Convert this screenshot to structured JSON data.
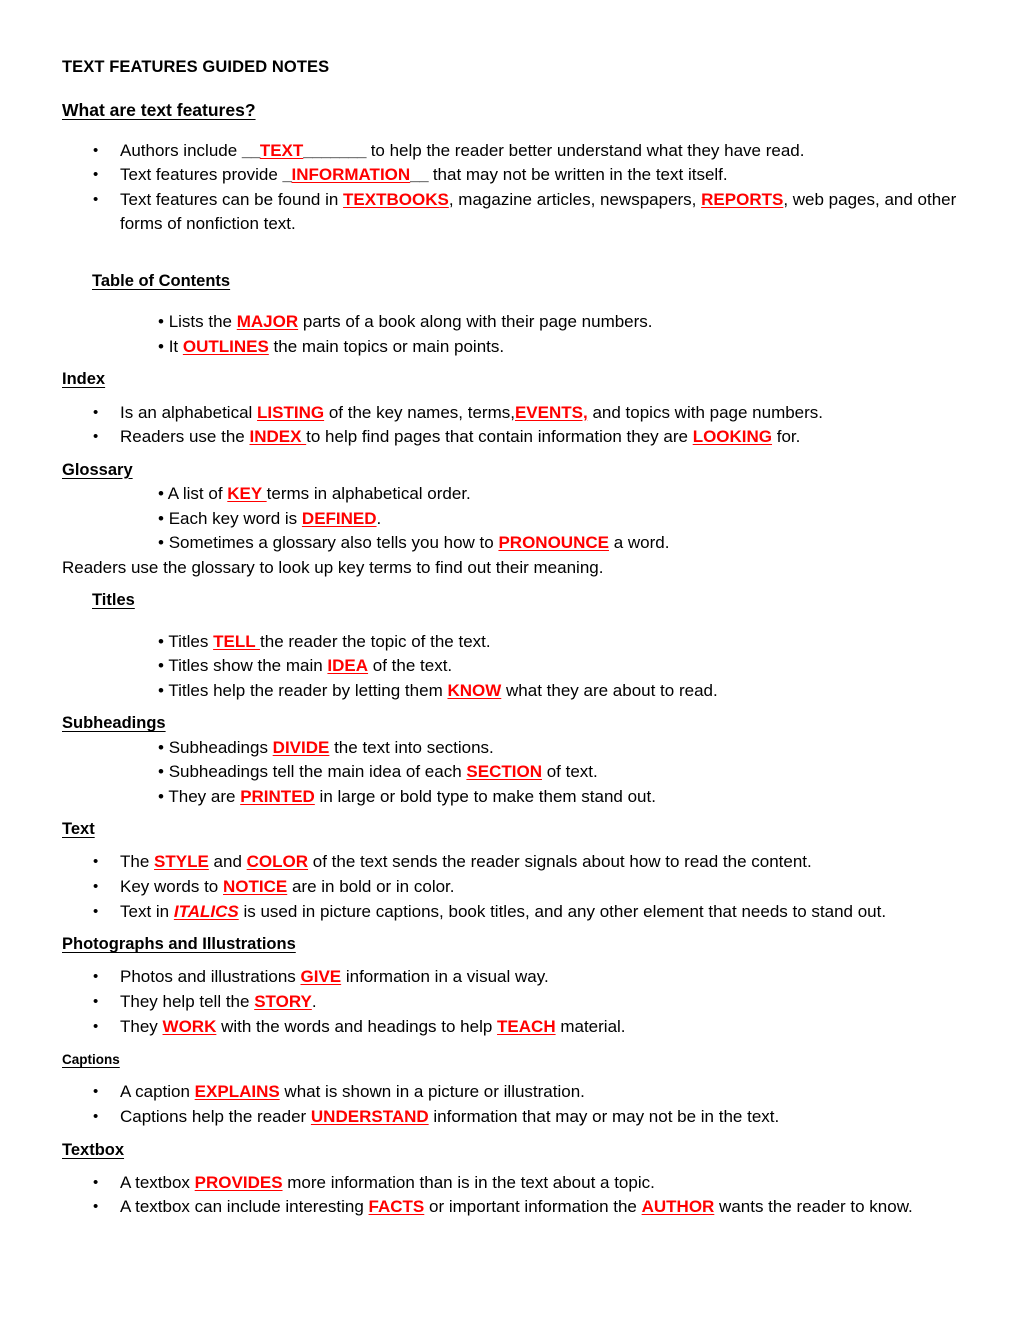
{
  "document": {
    "title": "TEXT FEATURES GUIDED NOTES",
    "intro_heading": "What are text features?",
    "accent_color": "#FF0000",
    "text_color": "#000000",
    "background_color": "#FFFFFF",
    "bullet_glyph": "•"
  },
  "intro": {
    "bullets": [
      {
        "pre": "Authors include ",
        "blank_before": "__",
        "answer": "TEXT",
        "blank_after": "_______",
        "post": " to help the reader better understand what they have read."
      },
      {
        "pre": "Text features provide ",
        "blank_before": "_",
        "answer": "INFORMATION",
        "blank_after": "__",
        "post": " that may not be written in the text itself."
      },
      {
        "pre": "Text features can be found in ",
        "answer": "TEXTBOOKS",
        "mid": ", magazine articles, newspapers, ",
        "answer2": "REPORTS",
        "post": ", web pages, and other forms of nonfiction text."
      }
    ]
  },
  "sections": [
    {
      "heading": "Table of Contents",
      "heading_indent": true,
      "heading_size": "normal",
      "lines": [
        {
          "style": "sub",
          "pre": "Lists the ",
          "answer": "MAJOR",
          "post": " parts of a book along with their page numbers."
        },
        {
          "style": "sub",
          "pre": "It ",
          "answer": "OUTLINES",
          "post": " the main topics or main points."
        }
      ]
    },
    {
      "heading": "Index",
      "heading_indent": false,
      "heading_size": "normal",
      "lines": [
        {
          "style": "bullet",
          "pre": "Is an alphabetical ",
          "answer": "LISTING",
          "mid": " of the key names, terms,",
          "answer2": "EVENTS,",
          "post": " and topics with page numbers."
        },
        {
          "style": "bullet",
          "pre": "Readers use the ",
          "answer": "INDEX ",
          "mid": "to help find pages that contain information they are ",
          "answer2": "LOOKING",
          "post": " for."
        }
      ]
    },
    {
      "heading": "Glossary",
      "heading_indent": false,
      "heading_size": "normal",
      "lines": [
        {
          "style": "sub",
          "pre": "A list of ",
          "answer": "KEY ",
          "post": "terms in alphabetical order."
        },
        {
          "style": "sub",
          "pre": "Each key word is ",
          "answer": "DEFINED",
          "post": "."
        },
        {
          "style": "sub",
          "pre": "Sometimes a glossary also tells you how to ",
          "answer": "PRONOUNCE",
          "post": " a word."
        },
        {
          "style": "plain",
          "pre": "Readers use the glossary to look up key terms to find out their meaning."
        }
      ]
    },
    {
      "heading": "Titles",
      "heading_indent": true,
      "heading_size": "normal",
      "lines": [
        {
          "style": "sub",
          "pre": "Titles ",
          "answer": "TELL ",
          "post": "the reader the topic of the text."
        },
        {
          "style": "sub",
          "pre": "Titles show the main ",
          "answer": "IDEA",
          "post": " of the text."
        },
        {
          "style": "sub",
          "pre": "Titles help the reader by letting them ",
          "answer": "KNOW",
          "post": " what they are about to read."
        }
      ]
    },
    {
      "heading": "Subheadings",
      "heading_indent": false,
      "heading_size": "normal",
      "lines": [
        {
          "style": "sub",
          "pre": "Subheadings ",
          "answer": "DIVIDE",
          "post": " the text into sections."
        },
        {
          "style": "sub",
          "pre": "Subheadings tell the main idea of each ",
          "answer": "SECTION",
          "post": " of text."
        },
        {
          "style": "sub",
          "pre": "They are ",
          "answer": "PRINTED",
          "post": " in large or bold type to make them stand out."
        }
      ]
    },
    {
      "heading": "Text",
      "heading_indent": false,
      "heading_size": "normal",
      "lines": [
        {
          "style": "bullet",
          "pre": "The ",
          "answer": "STYLE",
          "mid": " and ",
          "answer2": "COLOR",
          "post": " of the text sends the reader signals about how to read the content."
        },
        {
          "style": "bullet",
          "pre": "Key words to ",
          "answer": "NOTICE",
          "post": " are in bold or in color."
        },
        {
          "style": "bullet",
          "pre": "Text in ",
          "answer": "ITALICS",
          "answer_italic": true,
          "post": " is used in picture captions, book titles, and any other element that needs to stand out."
        }
      ]
    },
    {
      "heading": "Photographs and Illustrations",
      "heading_indent": false,
      "heading_size": "normal",
      "lines": [
        {
          "style": "bullet",
          "pre": "Photos and illustrations ",
          "answer": "GIVE",
          "post": " information in a visual way."
        },
        {
          "style": "bullet",
          "pre": "They help tell the ",
          "answer": "STORY",
          "post": "."
        },
        {
          "style": "bullet",
          "pre": "They ",
          "answer": "WORK",
          "mid": " with the words and headings to help ",
          "answer2": "TEACH",
          "post": " material."
        }
      ]
    },
    {
      "heading": "Captions",
      "heading_indent": false,
      "heading_size": "small",
      "lines": [
        {
          "style": "bullet",
          "pre": "A caption ",
          "answer": "EXPLAINS",
          "post": " what is shown in a picture or illustration."
        },
        {
          "style": "bullet",
          "pre": "Captions help the reader ",
          "answer": "UNDERSTAND",
          "post": " information that may or may not be in the text."
        }
      ]
    },
    {
      "heading": "Textbox",
      "heading_indent": false,
      "heading_size": "normal",
      "lines": [
        {
          "style": "bullet",
          "pre": "A textbox ",
          "answer": "PROVIDES",
          "post": " more information than is in the text about a topic."
        },
        {
          "style": "bullet",
          "pre": "A textbox can include interesting ",
          "answer": "FACTS",
          "mid": " or important information the ",
          "answer2": "AUTHOR",
          "post": " wants the reader to know."
        }
      ]
    }
  ]
}
